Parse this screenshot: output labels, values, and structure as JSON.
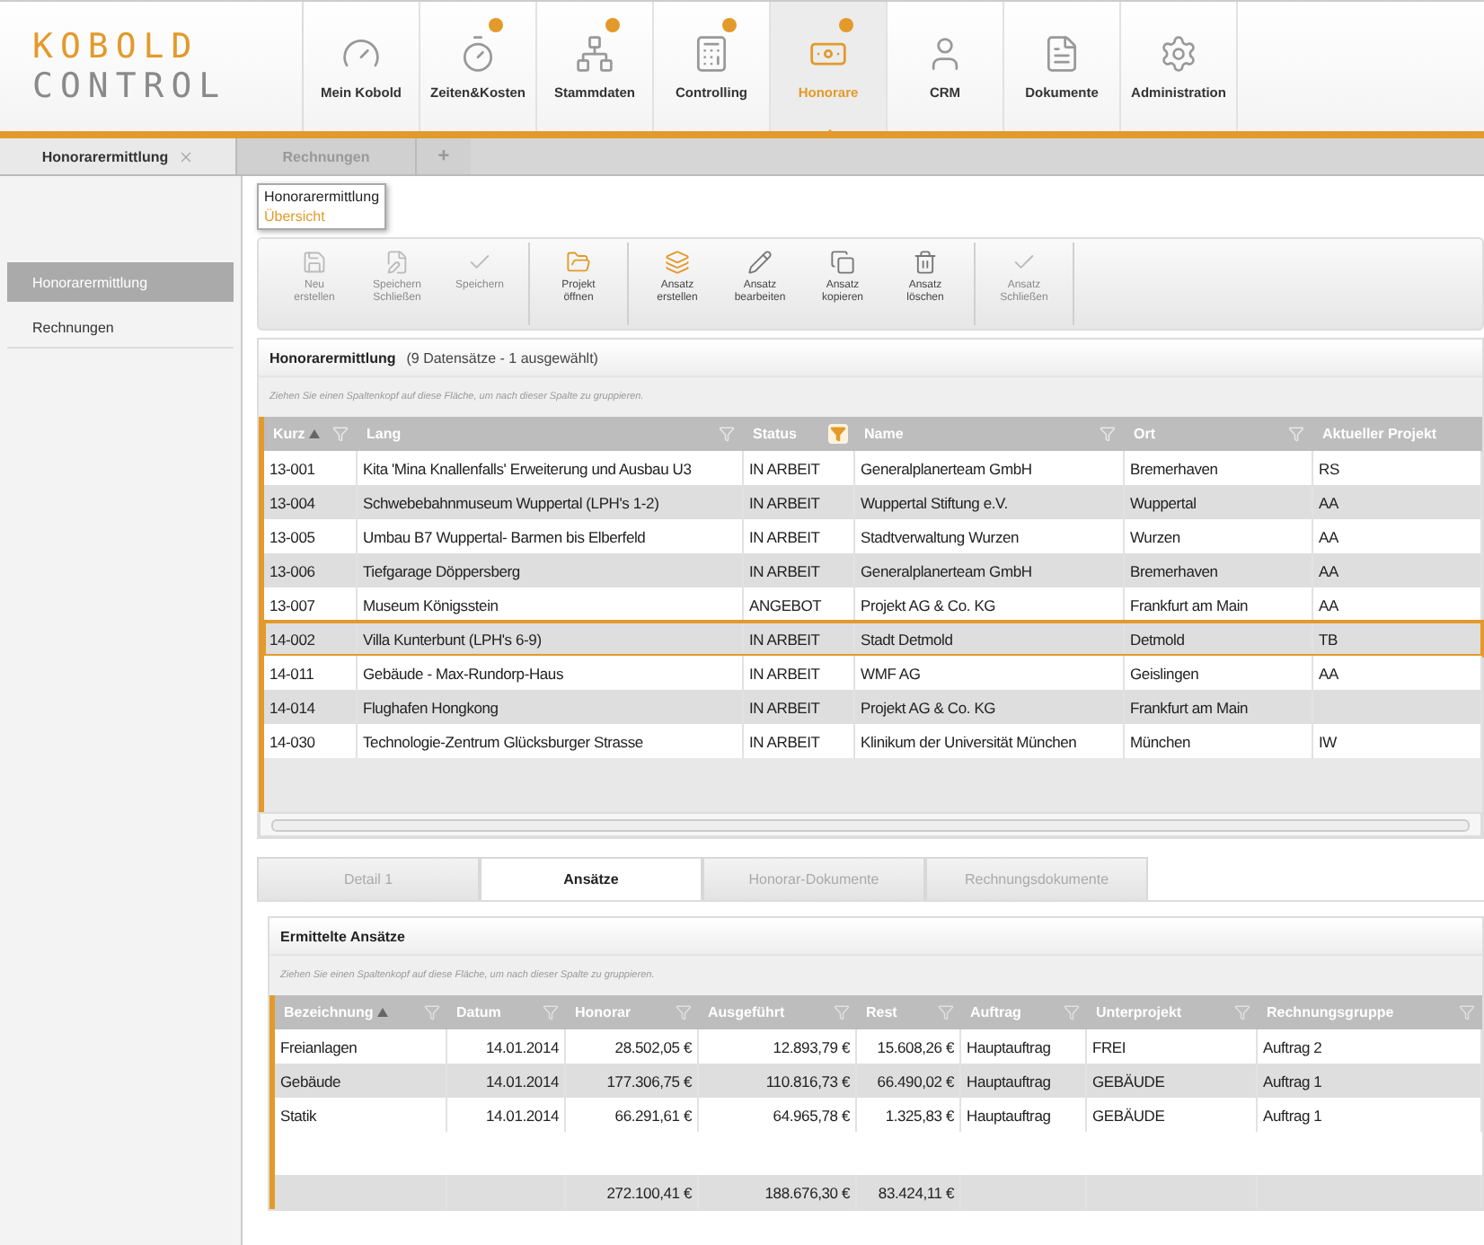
{
  "logo": {
    "line_1": "KOBOLD",
    "line_2": "CONTROL"
  },
  "nav": [
    {
      "label": "Mein Kobold",
      "badge": false,
      "selected": false
    },
    {
      "label": "Zeiten&Kosten",
      "badge": true,
      "selected": false
    },
    {
      "label": "Stammdaten",
      "badge": true,
      "selected": false
    },
    {
      "label": "Controlling",
      "badge": true,
      "selected": false
    },
    {
      "label": "Honorare",
      "badge": true,
      "selected": true
    },
    {
      "label": "CRM",
      "badge": false,
      "selected": false
    },
    {
      "label": "Dokumente",
      "badge": false,
      "selected": false
    },
    {
      "label": "Administration",
      "badge": false,
      "selected": false
    }
  ],
  "page_tabs": {
    "tabs": [
      {
        "label": "Honorarermittlung",
        "selected": true
      },
      {
        "label": "Rechnungen",
        "selected": false
      }
    ],
    "add": "+"
  },
  "breadcrumb_menu": {
    "items": [
      {
        "label": "Honorarermittlung",
        "selected": false
      },
      {
        "label": "Übersicht",
        "selected": true
      }
    ]
  },
  "sidebar": {
    "items": [
      {
        "label": "Honorarermittlung",
        "selected": true
      },
      {
        "label": "Rechnungen",
        "selected": false
      }
    ]
  },
  "toolbar": {
    "groups": [
      [
        {
          "label": "Neu erstellen",
          "disabled": true
        },
        {
          "label": "Speichern Schließen",
          "disabled": true
        },
        {
          "label": "Speichern",
          "disabled": true
        }
      ],
      [
        {
          "label": "Projekt öffnen",
          "disabled": false
        }
      ],
      [
        {
          "label": "Ansatz erstellen",
          "disabled": false
        },
        {
          "label": "Ansatz bearbeiten",
          "disabled": false
        },
        {
          "label": "Ansatz kopieren",
          "disabled": false
        },
        {
          "label": "Ansatz löschen",
          "disabled": false
        }
      ],
      [
        {
          "label": "Ansatz Schließen",
          "disabled": true
        }
      ]
    ]
  },
  "projects": {
    "title": "Honorarermittlung",
    "count": "(9 Datensätze - 1 ausgewählt)",
    "group_hint": "Ziehen Sie einen Spaltenkopf auf diese Fläche, um nach dieser Spalte zu gruppieren.",
    "columns": [
      {
        "label": "Kurz",
        "sorted": true,
        "filtered": false
      },
      {
        "label": "Lang",
        "sorted": false,
        "filtered": false
      },
      {
        "label": "Status",
        "sorted": false,
        "filtered": true
      },
      {
        "label": "Name",
        "sorted": false,
        "filtered": false
      },
      {
        "label": "Ort",
        "sorted": false,
        "filtered": false
      },
      {
        "label": "Aktueller Projekt",
        "sorted": false
      }
    ],
    "rows": [
      {
        "selected": false,
        "cells": [
          "13-001",
          "Kita 'Mina Knallenfalls' Erweiterung und Ausbau U3",
          "IN ARBEIT",
          "Generalplanerteam GmbH",
          "Bremerhaven",
          "RS"
        ]
      },
      {
        "selected": false,
        "cells": [
          "13-004",
          "Schwebebahnmuseum Wuppertal (LPH's 1-2)",
          "IN ARBEIT",
          "Wuppertal Stiftung e.V.",
          "Wuppertal",
          "AA"
        ]
      },
      {
        "selected": false,
        "cells": [
          "13-005",
          "Umbau B7 Wuppertal- Barmen bis Elberfeld",
          "IN ARBEIT",
          "Stadtverwaltung Wurzen",
          "Wurzen",
          "AA"
        ]
      },
      {
        "selected": false,
        "cells": [
          "13-006",
          "Tiefgarage Döppersberg",
          "IN ARBEIT",
          "Generalplanerteam GmbH",
          "Bremerhaven",
          "AA"
        ]
      },
      {
        "selected": false,
        "cells": [
          "13-007",
          "Museum Königsstein",
          "ANGEBOT",
          "Projekt AG & Co. KG",
          "Frankfurt am Main",
          "AA"
        ]
      },
      {
        "selected": true,
        "cells": [
          "14-002",
          "Villa Kunterbunt (LPH's 6-9)",
          "IN ARBEIT",
          "Stadt Detmold",
          "Detmold",
          "TB"
        ]
      },
      {
        "selected": false,
        "cells": [
          "14-011",
          "Gebäude - Max-Rundorp-Haus",
          "IN ARBEIT",
          "WMF AG",
          "Geislingen",
          "AA"
        ]
      },
      {
        "selected": false,
        "cells": [
          "14-014",
          "Flughafen Hongkong",
          "IN ARBEIT",
          "Projekt AG & Co. KG",
          "Frankfurt am Main",
          ""
        ]
      },
      {
        "selected": false,
        "cells": [
          "14-030",
          "Technologie-Zentrum Glücksburger Strasse",
          "IN ARBEIT",
          "Klinikum der Universität München",
          "München",
          "IW"
        ]
      }
    ]
  },
  "detail_tabs": [
    {
      "label": "Detail 1",
      "selected": false
    },
    {
      "label": "Ansätze",
      "selected": true
    },
    {
      "label": "Honorar-Dokumente",
      "selected": false
    },
    {
      "label": "Rechnungsdokumente",
      "selected": false
    }
  ],
  "approaches": {
    "title": "Ermittelte Ansätze",
    "group_hint": "Ziehen Sie einen Spaltenkopf auf diese Fläche, um nach dieser Spalte zu gruppieren.",
    "columns": [
      {
        "label": "Bezeichnung",
        "sorted": true,
        "kind": "text"
      },
      {
        "label": "Datum",
        "sorted": false,
        "kind": "number"
      },
      {
        "label": "Honorar",
        "sorted": false,
        "kind": "number"
      },
      {
        "label": "Ausgeführt",
        "sorted": false,
        "kind": "number"
      },
      {
        "label": "Rest",
        "sorted": false,
        "kind": "number"
      },
      {
        "label": "Auftrag",
        "sorted": false,
        "kind": "text"
      },
      {
        "label": "Unterprojekt",
        "sorted": false,
        "kind": "text"
      },
      {
        "label": "Rechnungsgruppe",
        "sorted": false,
        "kind": "text"
      }
    ],
    "rows": [
      {
        "selected": false,
        "cells": [
          "Freianlagen",
          "14.01.2014",
          "28.502,05 €",
          "12.893,79 €",
          "15.608,26 €",
          "Hauptauftrag",
          "FREI",
          "Auftrag 2"
        ]
      },
      {
        "selected": false,
        "cells": [
          "Gebäude",
          "14.01.2014",
          "177.306,75 €",
          "110.816,73 €",
          "66.490,02 €",
          "Hauptauftrag",
          "GEBÄUDE",
          "Auftrag 1"
        ]
      },
      {
        "selected": false,
        "cells": [
          "Statik",
          "14.01.2014",
          "66.291,61 €",
          "64.965,78 €",
          "1.325,83 €",
          "Hauptauftrag",
          "GEBÄUDE",
          "Auftrag 1"
        ]
      }
    ],
    "totals": {
      "honorar": "272.100,41 €",
      "ausgefuehrt": "188.676,30 €",
      "rest": "83.424,11 €"
    }
  }
}
